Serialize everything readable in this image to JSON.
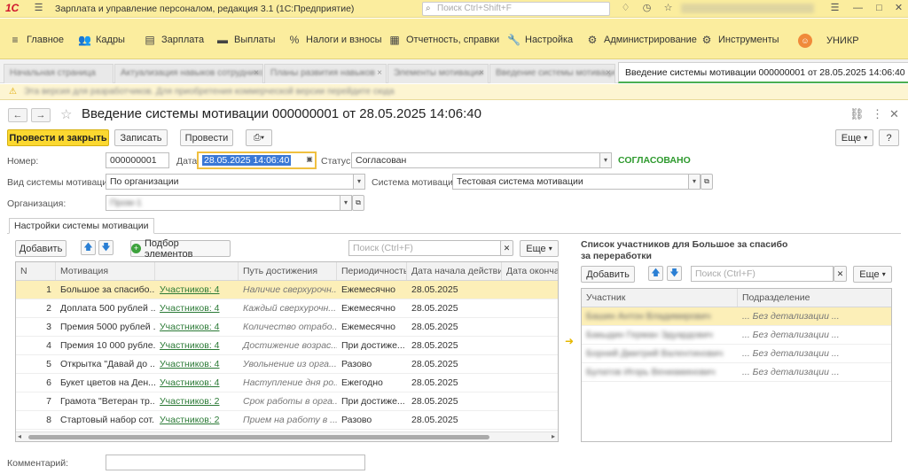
{
  "titlebar": {
    "title": "Зарплата и управление персоналом, редакция 3.1  (1С:Предприятие)",
    "search_placeholder": "Поиск Ctrl+Shift+F"
  },
  "menu": [
    {
      "icon": "hamburger-icon",
      "label": "Главное"
    },
    {
      "icon": "people-icon",
      "label": "Кадры"
    },
    {
      "icon": "ledger-icon",
      "label": "Зарплата"
    },
    {
      "icon": "money-icon",
      "label": "Выплаты"
    },
    {
      "icon": "percent-icon",
      "label": "Налоги и взносы"
    },
    {
      "icon": "report-icon",
      "label": "Отчетность, справки"
    },
    {
      "icon": "wrench-icon",
      "label": "Настройка"
    },
    {
      "icon": "gear-icon",
      "label": "Администрирование"
    },
    {
      "icon": "tools-icon",
      "label": "Инструменты"
    },
    {
      "icon": "unikr-icon",
      "label": "УНИКР"
    }
  ],
  "open_tabs": [
    "Начальная страница",
    "Актуализация навыков сотрудников",
    "Планы развития навыков",
    "Элементы мотивации",
    "Введение системы мотивации"
  ],
  "active_tab": "Введение системы мотивации 000000001 от 28.05.2025 14:06:40",
  "warning": "Эта версия для разработчиков. Для приобретения коммерческой версии перейдите сюда",
  "doc": {
    "title": "Введение системы мотивации 000000001 от 28.05.2025 14:06:40",
    "buttons": {
      "post_close": "Провести и закрыть",
      "save": "Записать",
      "post": "Провести",
      "more": "Еще",
      "help": "?"
    },
    "number_label": "Номер:",
    "number": "000000001",
    "date_label": "Дата:",
    "date": "28.05.2025 14:06:40",
    "status_label": "Статус:",
    "status": "Согласован",
    "status_badge": "СОГЛАСОВАНО",
    "kind_label": "Вид системы мотивации:",
    "kind": "По организации",
    "system_label": "Система мотивации:",
    "system": "Тестовая система мотивации",
    "org_label": "Организация:",
    "org": "Пром-1",
    "comment_label": "Комментарий:",
    "comment": ""
  },
  "group_tab": "Настройки системы мотивации",
  "left_toolbar": {
    "add": "Добавить",
    "pick": "Подбор элементов",
    "search_placeholder": "Поиск (Ctrl+F)",
    "more": "Еще"
  },
  "table": {
    "headers": [
      "N",
      "Мотивация",
      "",
      "Путь достижения",
      "Периодичность",
      "Дата начала действия",
      "Дата окончан"
    ],
    "rows": [
      {
        "n": "1",
        "motive": "Большое за спасибо...",
        "participants": "Участников: 4",
        "path": "Наличие сверхурочн...",
        "period": "Ежемесячно",
        "start": "28.05.2025"
      },
      {
        "n": "2",
        "motive": "Доплата 500 рублей ...",
        "participants": "Участников: 4",
        "path": "Каждый сверхурочн...",
        "period": "Ежемесячно",
        "start": "28.05.2025"
      },
      {
        "n": "3",
        "motive": "Премия 5000 рублей ...",
        "participants": "Участников: 4",
        "path": "Количество отрабо...",
        "period": "Ежемесячно",
        "start": "28.05.2025"
      },
      {
        "n": "4",
        "motive": "Премия 10 000 рубле...",
        "participants": "Участников: 4",
        "path": "Достижение возрас...",
        "period": "При достиже...",
        "start": "28.05.2025"
      },
      {
        "n": "5",
        "motive": "Открытка \"Давай до ...",
        "participants": "Участников: 4",
        "path": "Увольнение из орга...",
        "period": "Разово",
        "start": "28.05.2025"
      },
      {
        "n": "6",
        "motive": "Букет цветов на Ден...",
        "participants": "Участников: 4",
        "path": "Наступление дня ро...",
        "period": "Ежегодно",
        "start": "28.05.2025"
      },
      {
        "n": "7",
        "motive": "Грамота \"Ветеран тр...",
        "participants": "Участников: 2",
        "path": "Срок работы в орга...",
        "period": "При достиже...",
        "start": "28.05.2025"
      },
      {
        "n": "8",
        "motive": "Стартовый набор сот...",
        "participants": "Участников: 2",
        "path": "Прием на работу в ...",
        "period": "Разово",
        "start": "28.05.2025"
      }
    ]
  },
  "right_panel": {
    "title": "Список участников для Большое за спасибо за переработки",
    "add": "Добавить",
    "search_placeholder": "Поиск (Ctrl+F)",
    "more": "Еще",
    "headers": [
      "Участник",
      "Подразделение"
    ],
    "rows": [
      {
        "name": "Башин Антон Владимирович",
        "dept": "... Без детализации ..."
      },
      {
        "name": "Бакыдин Герман Эдуардович",
        "dept": "... Без детализации ..."
      },
      {
        "name": "Борний Дмитрий Валентинович",
        "dept": "... Без детализации ..."
      },
      {
        "name": "Булатов Игорь Вениаминович",
        "dept": "... Без детализации ..."
      }
    ]
  },
  "colors": {
    "accent_yellow": "#fbd830",
    "titlebar": "#fbed9e",
    "selection": "#fcefb8",
    "link_green": "#2b7a36",
    "ok_green": "#2e9a2e"
  }
}
